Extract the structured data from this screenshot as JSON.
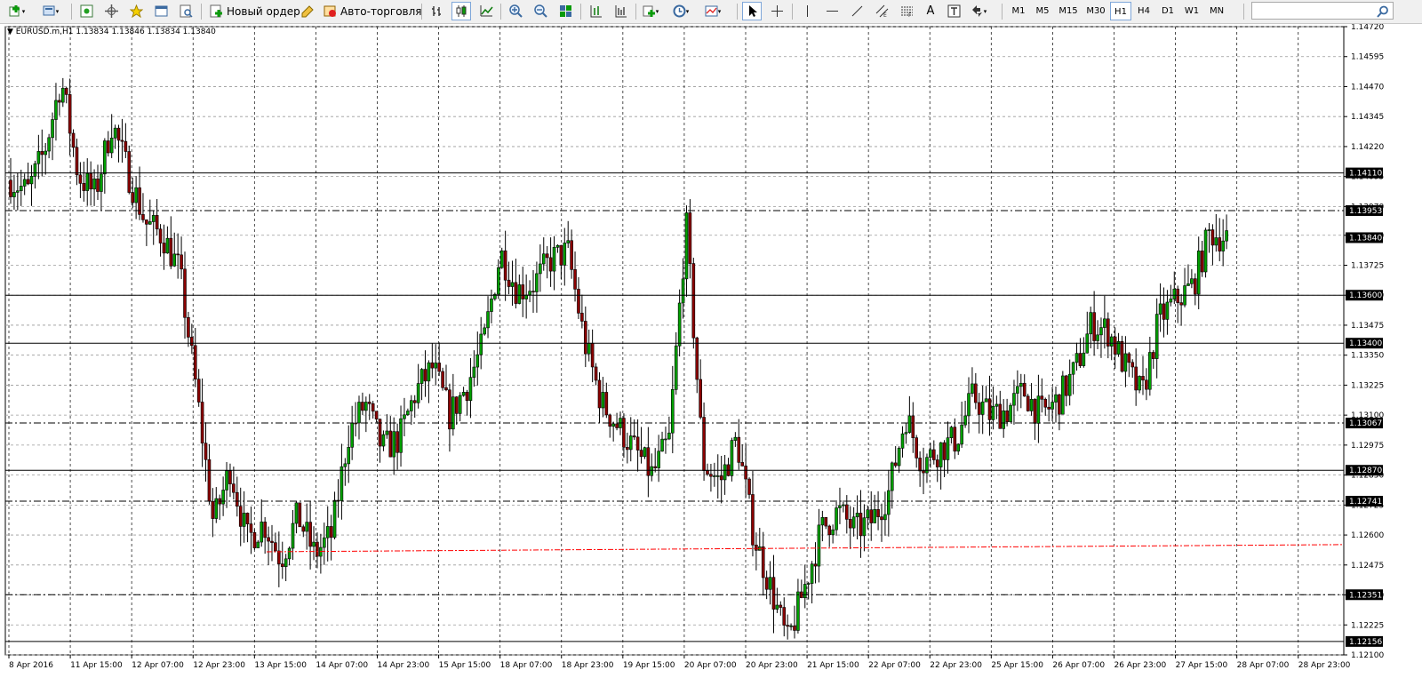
{
  "toolbar": {
    "new_order_label": "Новый ордер",
    "auto_trading_label": "Авто-торговля",
    "text_tool_label": "A",
    "timeframes": [
      "M1",
      "M5",
      "M15",
      "M30",
      "H1",
      "H4",
      "D1",
      "W1",
      "MN"
    ],
    "active_timeframe": "H1"
  },
  "chart_header": {
    "symbol": "EURUSD.m,H1",
    "ohlc": "1.13834 1.13846 1.13834 1.13840"
  },
  "chart_data": {
    "type": "candlestick",
    "ylim": [
      1.121,
      1.1472
    ],
    "price_axis": {
      "ticks": [
        "1.14720",
        "1.14595",
        "1.14470",
        "1.14345",
        "1.14220",
        "1.14095",
        "1.13970",
        "1.13850",
        "1.13725",
        "1.13600",
        "1.13475",
        "1.13350",
        "1.13225",
        "1.13100",
        "1.12975",
        "1.12850",
        "1.12725",
        "1.12600",
        "1.12475",
        "1.12350",
        "1.12225",
        "1.12100"
      ],
      "levels": [
        {
          "value": 1.1411,
          "label": "1.14110",
          "style": "solid"
        },
        {
          "value": 1.13953,
          "label": "1.13953",
          "style": "dashdot"
        },
        {
          "value": 1.1384,
          "label": "1.13840",
          "style": "current"
        },
        {
          "value": 1.136,
          "label": "1.13600",
          "style": "solid"
        },
        {
          "value": 1.134,
          "label": "1.13400",
          "style": "solid"
        },
        {
          "value": 1.13067,
          "label": "1.13067",
          "style": "dashdot"
        },
        {
          "value": 1.1287,
          "label": "1.12870",
          "style": "solid"
        },
        {
          "value": 1.12741,
          "label": "1.12741",
          "style": "dashdot"
        },
        {
          "value": 1.12351,
          "label": "1.12351",
          "style": "dashdot"
        },
        {
          "value": 1.12156,
          "label": "1.12156",
          "style": "solid"
        }
      ]
    },
    "time_axis": [
      "8 Apr 2016",
      "11 Apr 15:00",
      "12 Apr 07:00",
      "12 Apr 23:00",
      "13 Apr 15:00",
      "14 Apr 07:00",
      "14 Apr 23:00",
      "15 Apr 15:00",
      "18 Apr 07:00",
      "18 Apr 23:00",
      "19 Apr 15:00",
      "20 Apr 07:00",
      "20 Apr 23:00",
      "21 Apr 15:00",
      "22 Apr 07:00",
      "22 Apr 23:00",
      "25 Apr 15:00",
      "26 Apr 07:00",
      "26 Apr 23:00",
      "27 Apr 15:00",
      "28 Apr 07:00",
      "28 Apr 23:00"
    ],
    "close_path": [
      1.1408,
      1.1403,
      1.142,
      1.145,
      1.141,
      1.1402,
      1.1432,
      1.141,
      1.139,
      1.1385,
      1.137,
      1.132,
      1.1265,
      1.1288,
      1.1258,
      1.1265,
      1.125,
      1.1268,
      1.1252,
      1.126,
      1.1302,
      1.1315,
      1.1296,
      1.13,
      1.132,
      1.133,
      1.131,
      1.1322,
      1.134,
      1.1378,
      1.1362,
      1.1365,
      1.1375,
      1.1378,
      1.134,
      1.1315,
      1.1305,
      1.1295,
      1.1285,
      1.13,
      1.139,
      1.129,
      1.1282,
      1.13,
      1.126,
      1.1238,
      1.1215,
      1.1238,
      1.1262,
      1.127,
      1.1262,
      1.1266,
      1.1278,
      1.131,
      1.129,
      1.1296,
      1.13,
      1.1318,
      1.131,
      1.1312,
      1.132,
      1.131,
      1.1316,
      1.1328,
      1.1348,
      1.1345,
      1.133,
      1.1318,
      1.135,
      1.1358,
      1.1364,
      1.1386,
      1.1384
    ],
    "colors": {
      "bull": "#00a000",
      "bear": "#8b0000",
      "wick": "#000000",
      "grid": "#9a9a9a",
      "average_line": "#ff0000"
    }
  }
}
